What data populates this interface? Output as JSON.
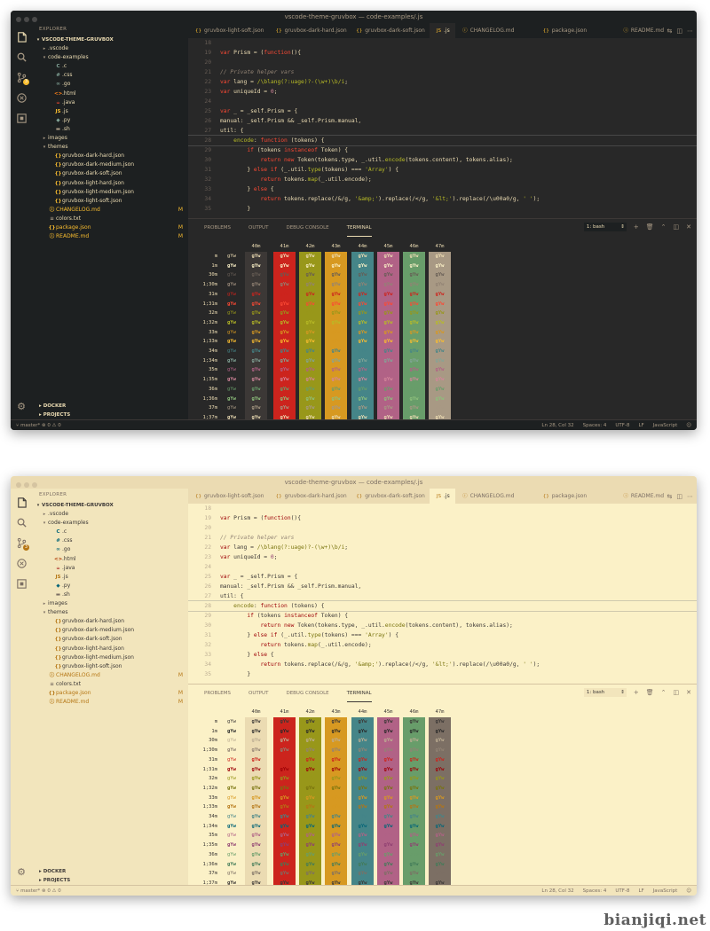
{
  "title": "vscode-theme-gruvbox — code-examples/.js",
  "explorer": "EXPLORER",
  "root": "VSCODE-THEME-GRUVBOX",
  "tree": [
    {
      "d": 1,
      "tw": "▸",
      "ic": "",
      "label": ".vscode",
      "kind": "folder"
    },
    {
      "d": 1,
      "tw": "▾",
      "ic": "",
      "label": "code-examples",
      "kind": "folder"
    },
    {
      "d": 2,
      "tw": "",
      "ic": "C",
      "label": ".c",
      "kind": "c"
    },
    {
      "d": 2,
      "tw": "",
      "ic": "#",
      "label": ".css",
      "kind": "css"
    },
    {
      "d": 2,
      "tw": "",
      "ic": "∞",
      "label": ".go",
      "kind": "go"
    },
    {
      "d": 2,
      "tw": "",
      "ic": "<>",
      "label": ".html",
      "kind": "html"
    },
    {
      "d": 2,
      "tw": "",
      "ic": "☕",
      "label": ".java",
      "kind": "java"
    },
    {
      "d": 2,
      "tw": "",
      "ic": "JS",
      "label": ".js",
      "kind": "js"
    },
    {
      "d": 2,
      "tw": "",
      "ic": "◆",
      "label": ".py",
      "kind": "py"
    },
    {
      "d": 2,
      "tw": "",
      "ic": "▬",
      "label": ".sh",
      "kind": "sh"
    },
    {
      "d": 1,
      "tw": "▸",
      "ic": "",
      "label": "images",
      "kind": "folder"
    },
    {
      "d": 1,
      "tw": "▾",
      "ic": "",
      "label": "themes",
      "kind": "folder"
    },
    {
      "d": 2,
      "tw": "",
      "ic": "{}",
      "label": "gruvbox-dark-hard.json",
      "kind": "json"
    },
    {
      "d": 2,
      "tw": "",
      "ic": "{}",
      "label": "gruvbox-dark-medium.json",
      "kind": "json"
    },
    {
      "d": 2,
      "tw": "",
      "ic": "{}",
      "label": "gruvbox-dark-soft.json",
      "kind": "json"
    },
    {
      "d": 2,
      "tw": "",
      "ic": "{}",
      "label": "gruvbox-light-hard.json",
      "kind": "json"
    },
    {
      "d": 2,
      "tw": "",
      "ic": "{}",
      "label": "gruvbox-light-medium.json",
      "kind": "json"
    },
    {
      "d": 2,
      "tw": "",
      "ic": "{}",
      "label": "gruvbox-light-soft.json",
      "kind": "json"
    },
    {
      "d": 1,
      "tw": "",
      "ic": "ⓘ",
      "label": "CHANGELOG.md",
      "kind": "mdmod",
      "mod": "M"
    },
    {
      "d": 1,
      "tw": "",
      "ic": "≡",
      "label": "colors.txt",
      "kind": "txt"
    },
    {
      "d": 1,
      "tw": "",
      "ic": "{}",
      "label": "package.json",
      "kind": "pkgmod",
      "mod": "M"
    },
    {
      "d": 1,
      "tw": "",
      "ic": "ⓘ",
      "label": "README.md",
      "kind": "mdmod",
      "mod": "M"
    }
  ],
  "sections": [
    "DOCKER",
    "PROJECTS"
  ],
  "tabs": [
    {
      "icon": "{}",
      "label": "gruvbox-light-soft.json",
      "active": false
    },
    {
      "icon": "{}",
      "label": "gruvbox-dark-hard.json",
      "active": false
    },
    {
      "icon": "{}",
      "label": "gruvbox-dark-soft.json",
      "active": false
    },
    {
      "icon": "JS",
      "label": ".js",
      "active": true
    },
    {
      "icon": "ⓘ",
      "label": "CHANGELOG.md",
      "active": false
    },
    {
      "icon": "{}",
      "label": "package.json",
      "active": false
    },
    {
      "icon": "ⓘ",
      "label": "README.md",
      "active": false
    }
  ],
  "code": [
    {
      "n": "18",
      "t": []
    },
    {
      "n": "19",
      "t": [
        [
          "kw",
          "var "
        ],
        [
          "pl",
          "Prism = ("
        ],
        [
          "kw",
          "function"
        ],
        [
          "pl",
          "(){"
        ]
      ]
    },
    {
      "n": "20",
      "t": []
    },
    {
      "n": "21",
      "t": [
        [
          "cm",
          "// Private helper vars"
        ]
      ]
    },
    {
      "n": "22",
      "t": [
        [
          "kw",
          "var "
        ],
        [
          "pl",
          "lang = "
        ],
        [
          "rx",
          "/\\blang(?:uage)?-(\\w+)\\b/i"
        ],
        [
          "pl",
          ";"
        ]
      ]
    },
    {
      "n": "23",
      "t": [
        [
          "kw",
          "var "
        ],
        [
          "pl",
          "uniqueId = "
        ],
        [
          "nu",
          "0"
        ],
        [
          "pl",
          ";"
        ]
      ]
    },
    {
      "n": "24",
      "t": []
    },
    {
      "n": "25",
      "t": [
        [
          "kw",
          "var "
        ],
        [
          "pl",
          "_ = _self.Prism = {"
        ]
      ]
    },
    {
      "n": "26",
      "t": [
        [
          "pl",
          "manual: _self.Prism && _self.Prism.manual,"
        ]
      ]
    },
    {
      "n": "27",
      "t": [
        [
          "pl",
          "util: {"
        ]
      ]
    },
    {
      "n": "28",
      "t": [
        [
          "pl",
          "    "
        ],
        [
          "fn",
          "encode"
        ],
        [
          "pl",
          ": "
        ],
        [
          "kw",
          "function "
        ],
        [
          "pl",
          "(tokens) {"
        ]
      ],
      "cur": true
    },
    {
      "n": "29",
      "t": [
        [
          "pl",
          "        "
        ],
        [
          "kw",
          "if "
        ],
        [
          "pl",
          "(tokens "
        ],
        [
          "kw",
          "instanceof "
        ],
        [
          "pl",
          "Token) {"
        ]
      ]
    },
    {
      "n": "30",
      "t": [
        [
          "pl",
          "            "
        ],
        [
          "kw",
          "return new "
        ],
        [
          "pl",
          "Token(tokens.type, _.util."
        ],
        [
          "fn",
          "encode"
        ],
        [
          "pl",
          "(tokens.content), tokens.alias);"
        ]
      ]
    },
    {
      "n": "31",
      "t": [
        [
          "pl",
          "        } "
        ],
        [
          "kw",
          "else if "
        ],
        [
          "pl",
          "(_.util."
        ],
        [
          "fn",
          "type"
        ],
        [
          "pl",
          "(tokens) === "
        ],
        [
          "st",
          "'Array'"
        ],
        [
          "pl",
          ") {"
        ]
      ]
    },
    {
      "n": "32",
      "t": [
        [
          "pl",
          "            "
        ],
        [
          "kw",
          "return "
        ],
        [
          "pl",
          "tokens."
        ],
        [
          "fn",
          "map"
        ],
        [
          "pl",
          "(_.util.encode);"
        ]
      ]
    },
    {
      "n": "33",
      "t": [
        [
          "pl",
          "        } "
        ],
        [
          "kw",
          "else "
        ],
        [
          "pl",
          "{"
        ]
      ]
    },
    {
      "n": "34",
      "t": [
        [
          "pl",
          "            "
        ],
        [
          "kw",
          "return "
        ],
        [
          "pl",
          "tokens.replace(/&/g, "
        ],
        [
          "st",
          "'&amp;'"
        ],
        [
          "pl",
          ").replace(/</g, "
        ],
        [
          "st",
          "'&lt;'"
        ],
        [
          "pl",
          ").replace(/\\u00a0/g, "
        ],
        [
          "st",
          "' '"
        ],
        [
          "pl",
          ");"
        ]
      ]
    },
    {
      "n": "35",
      "t": [
        [
          "pl",
          "        }"
        ]
      ]
    }
  ],
  "panel_tabs": [
    "PROBLEMS",
    "OUTPUT",
    "DEBUG CONSOLE",
    "TERMINAL"
  ],
  "shell": "1: bash",
  "panel_ctrl_icons": [
    "add-terminal-icon",
    "trash-icon",
    "chevron-up-icon",
    "split-icon",
    "close-icon"
  ],
  "term_cols": [
    "40m",
    "41m",
    "42m",
    "43m",
    "44m",
    "45m",
    "46m",
    "47m"
  ],
  "term_rows": [
    "m",
    "1m",
    "30m",
    "1;30m",
    "31m",
    "1;31m",
    "32m",
    "1;32m",
    "33m",
    "1;33m",
    "34m",
    "1;34m",
    "35m",
    "1;35m",
    "36m",
    "1;36m",
    "37m",
    "1;37m"
  ],
  "term_sample": "gYw",
  "status": {
    "branch": "master*",
    "problems": "⊗ 0  ⚠ 0",
    "position": "Ln 28, Col 32",
    "spaces": "Spaces: 4",
    "encoding": "UTF-8",
    "eol": "LF",
    "language": "JavaScript"
  },
  "themes": [
    {
      "id": "dark",
      "bg": "#282828",
      "bg_side": "#1d2021",
      "bg_act": "#1d2021",
      "bg_tab": "#1d2021",
      "bg_tab_act": "#282828",
      "bg_title": "#1d2021",
      "fg": "#ebdbb2",
      "fg_dim": "#a89984",
      "ln": "#665c54",
      "bg_status": "#1d2021",
      "term": {
        "bg40": "#3c3836",
        "fg_norm": [
          "#ebdbb2",
          "#fbf1c7",
          "#665c54",
          "#928374",
          "#cc241d",
          "#fb4934",
          "#98971a",
          "#b8bb26",
          "#d79921",
          "#fabd2f",
          "#458588",
          "#83a598",
          "#b16286",
          "#d3869b",
          "#689d6a",
          "#8ec07c",
          "#a89984",
          "#ebdbb2"
        ],
        "col_bg": [
          "#3c3836",
          "#cc241d",
          "#98971a",
          "#d79921",
          "#458588",
          "#b16286",
          "#689d6a",
          "#a89984"
        ]
      },
      "syn": {
        "kw": "#fb4934",
        "pl": "#ebdbb2",
        "cm": "#928374",
        "rx": "#b8bb26",
        "nu": "#d3869b",
        "fn": "#b8bb26",
        "st": "#b8bb26"
      },
      "tree_colors": {
        "folder": "#ebdbb2",
        "c": "#83a598",
        "css": "#83a598",
        "go": "#83a598",
        "html": "#fe8019",
        "java": "#fb4934",
        "js": "#fabd2f",
        "py": "#83a598",
        "sh": "#a89984",
        "json": "#fabd2f",
        "mdmod": "#fabd2f",
        "txt": "#a89984",
        "pkgmod": "#fabd2f"
      },
      "accent": "#fabd2f",
      "lights": [
        "#4a4a4a",
        "#4a4a4a",
        "#4a4a4a"
      ]
    },
    {
      "id": "light",
      "bg": "#fbf1c7",
      "bg_side": "#f2e5bc",
      "bg_act": "#f2e5bc",
      "bg_tab": "#ebdbb2",
      "bg_tab_act": "#fbf1c7",
      "bg_title": "#ebdbb2",
      "fg": "#3c3836",
      "fg_dim": "#7c6f64",
      "ln": "#bdae93",
      "bg_status": "#f2e5bc",
      "term": {
        "bg40": "#fbf1c7",
        "fg_norm": [
          "#3c3836",
          "#282828",
          "#bdae93",
          "#928374",
          "#cc241d",
          "#9d0006",
          "#98971a",
          "#79740e",
          "#d79921",
          "#b57614",
          "#458588",
          "#076678",
          "#b16286",
          "#8f3f71",
          "#689d6a",
          "#427b58",
          "#7c6f64",
          "#3c3836"
        ],
        "col_bg": [
          "#ebdbb2",
          "#cc241d",
          "#98971a",
          "#d79921",
          "#458588",
          "#b16286",
          "#689d6a",
          "#7c6f64"
        ]
      },
      "syn": {
        "kw": "#9d0006",
        "pl": "#3c3836",
        "cm": "#928374",
        "rx": "#79740e",
        "nu": "#8f3f71",
        "fn": "#79740e",
        "st": "#79740e"
      },
      "tree_colors": {
        "folder": "#3c3836",
        "c": "#076678",
        "css": "#076678",
        "go": "#076678",
        "html": "#af3a03",
        "java": "#9d0006",
        "js": "#b57614",
        "py": "#076678",
        "sh": "#7c6f64",
        "json": "#b57614",
        "mdmod": "#b57614",
        "txt": "#7c6f64",
        "pkgmod": "#b57614"
      },
      "accent": "#b57614",
      "lights": [
        "#d5c4a1",
        "#d5c4a1",
        "#d5c4a1"
      ]
    }
  ],
  "watermark": "bianjiqi.net"
}
